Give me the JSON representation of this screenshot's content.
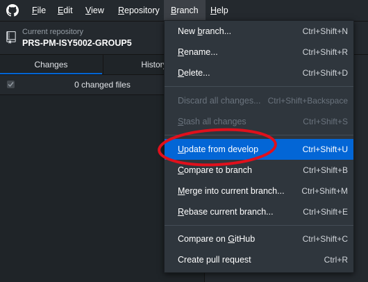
{
  "menubar": {
    "items": [
      {
        "label_pre": "",
        "label_mn": "F",
        "label_post": "ile"
      },
      {
        "label_pre": "",
        "label_mn": "E",
        "label_post": "dit"
      },
      {
        "label_pre": "",
        "label_mn": "V",
        "label_post": "iew"
      },
      {
        "label_pre": "",
        "label_mn": "R",
        "label_post": "epository"
      },
      {
        "label_pre": "",
        "label_mn": "B",
        "label_post": "ranch"
      },
      {
        "label_pre": "",
        "label_mn": "H",
        "label_post": "elp"
      }
    ],
    "active_menu": "Branch"
  },
  "toolbar": {
    "repo_caption": "Current repository",
    "repo_name": "PRS-PM-ISY5002-GROUP5"
  },
  "tabs": {
    "changes": "Changes",
    "history": "History"
  },
  "changes": {
    "summary": "0 changed files"
  },
  "branch_menu": {
    "items": [
      {
        "pre": "New ",
        "mn": "b",
        "post": "ranch...",
        "shortcut": "Ctrl+Shift+N",
        "state": "enabled"
      },
      {
        "pre": "",
        "mn": "R",
        "post": "ename...",
        "shortcut": "Ctrl+Shift+R",
        "state": "enabled"
      },
      {
        "pre": "",
        "mn": "D",
        "post": "elete...",
        "shortcut": "Ctrl+Shift+D",
        "state": "enabled"
      },
      {
        "pre": "Discard all changes...",
        "mn": "",
        "post": "",
        "shortcut": "Ctrl+Shift+Backspace",
        "state": "disabled"
      },
      {
        "pre": "",
        "mn": "S",
        "post": "tash all changes",
        "shortcut": "Ctrl+Shift+S",
        "state": "disabled"
      },
      {
        "pre": "",
        "mn": "U",
        "post": "pdate from develop",
        "shortcut": "Ctrl+Shift+U",
        "state": "highlighted"
      },
      {
        "pre": "",
        "mn": "C",
        "post": "ompare to branch",
        "shortcut": "Ctrl+Shift+B",
        "state": "enabled"
      },
      {
        "pre": "",
        "mn": "M",
        "post": "erge into current branch...",
        "shortcut": "Ctrl+Shift+M",
        "state": "enabled"
      },
      {
        "pre": "",
        "mn": "R",
        "post": "ebase current branch...",
        "shortcut": "Ctrl+Shift+E",
        "state": "enabled"
      },
      {
        "pre": "Compare on ",
        "mn": "G",
        "post": "itHub",
        "shortcut": "Ctrl+Shift+C",
        "state": "enabled"
      },
      {
        "pre": "Create pull request",
        "mn": "",
        "post": "",
        "shortcut": "Ctrl+R",
        "state": "enabled"
      }
    ]
  },
  "colors": {
    "accent": "#0366d6",
    "annotation": "#e0101c",
    "background": "#24292e",
    "menu_background": "#2f363d"
  },
  "icons": {
    "logo": "github-logo-icon",
    "repo": "repository-icon",
    "checkbox": "checkmark-icon"
  }
}
